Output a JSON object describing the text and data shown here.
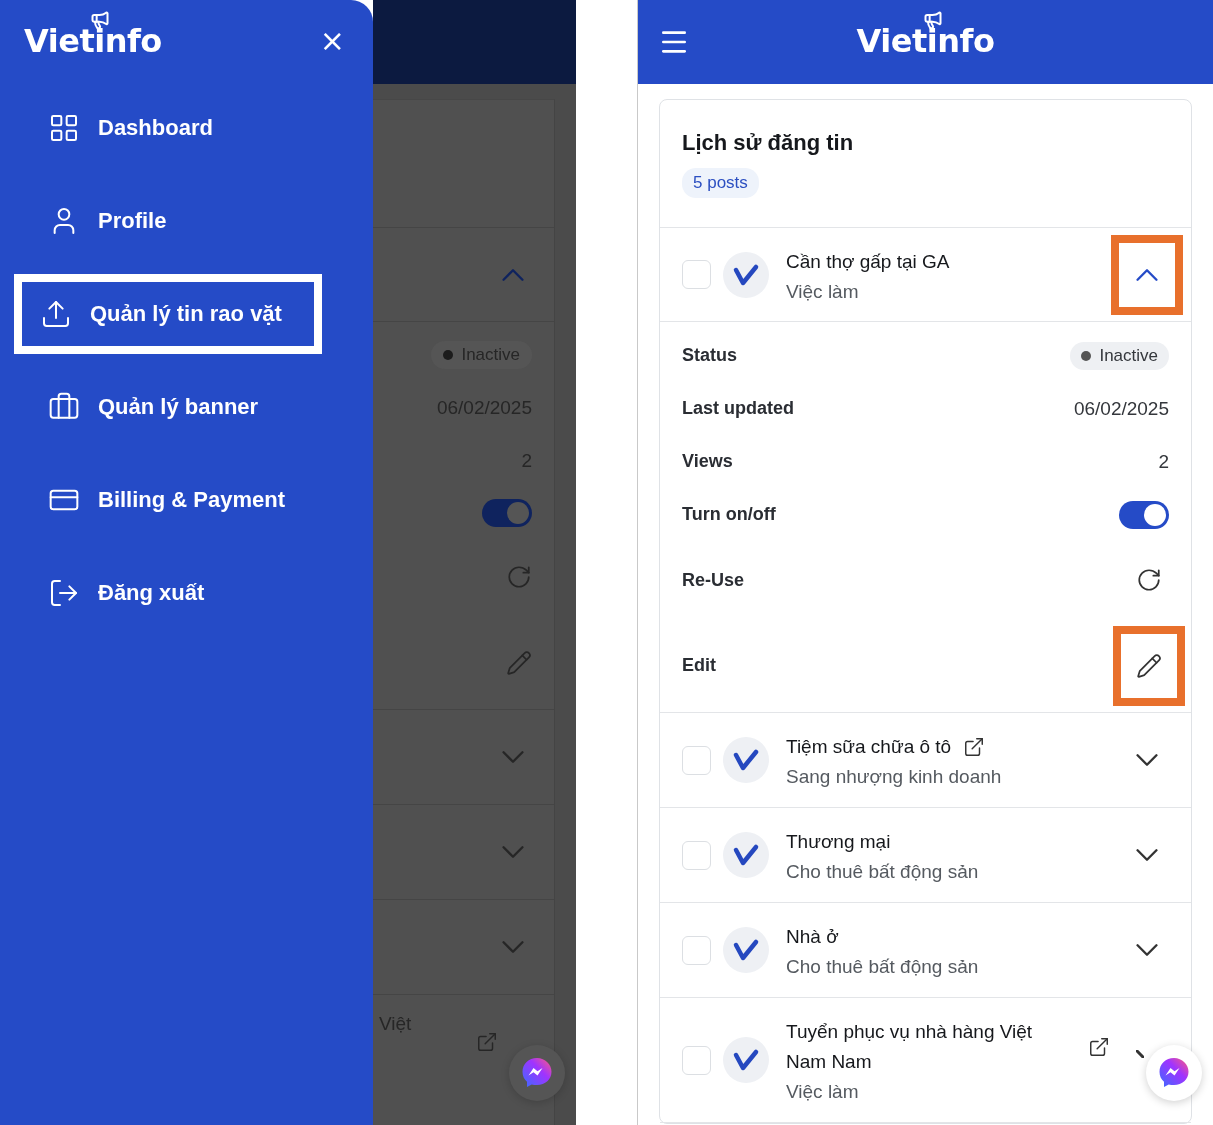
{
  "drawer": {
    "logo": "Vietinfo",
    "close": "×",
    "items": [
      {
        "label": "Dashboard",
        "selected": false
      },
      {
        "label": "Profile",
        "selected": false
      },
      {
        "label": "Quản lý tin rao vặt",
        "selected": true
      },
      {
        "label": "Quản lý banner",
        "selected": false
      },
      {
        "label": "Billing & Payment",
        "selected": false
      },
      {
        "label": "Đăng xuất",
        "selected": false
      }
    ]
  },
  "backdrop": {
    "status": "Inactive",
    "last_updated": "06/02/2025",
    "views": "2",
    "toggle_on": true,
    "title_fragment": "Việt"
  },
  "header": {
    "logo": "Vietinfo"
  },
  "history": {
    "title": "Lịch sử đăng tin",
    "count": "5 posts",
    "posts": [
      {
        "title": "Cần thợ gấp tại GA",
        "category": "Việc làm",
        "checked": false,
        "external_link": false,
        "expanded": true,
        "highlighted": true,
        "details": [
          {
            "kind": "badge",
            "label": "Status",
            "value": "Inactive"
          },
          {
            "kind": "text",
            "label": "Last updated",
            "value": "06/02/2025"
          },
          {
            "kind": "text",
            "label": "Views",
            "value": "2"
          },
          {
            "kind": "toggle",
            "label": "Turn on/off",
            "on": true
          },
          {
            "kind": "reuse",
            "label": "Re-Use",
            "highlighted": false
          },
          {
            "kind": "edit",
            "label": "Edit",
            "highlighted": true
          }
        ]
      },
      {
        "title": "Tiệm sữa chữa ô tô",
        "category": "Sang nhượng kinh doanh",
        "checked": false,
        "external_link": true,
        "expanded": false,
        "highlighted": false
      },
      {
        "title": "Thương mại",
        "category": "Cho thuê bất động sản",
        "checked": false,
        "external_link": false,
        "expanded": false,
        "highlighted": false
      },
      {
        "title": "Nhà ở",
        "category": "Cho thuê bất động sản",
        "checked": false,
        "external_link": false,
        "expanded": false,
        "highlighted": false
      },
      {
        "title": "Tuyển phục vụ nhà hàng Việt Nam Nam",
        "category": "Việc làm",
        "checked": false,
        "external_link": true,
        "expanded": false,
        "highlighted": false
      }
    ]
  }
}
